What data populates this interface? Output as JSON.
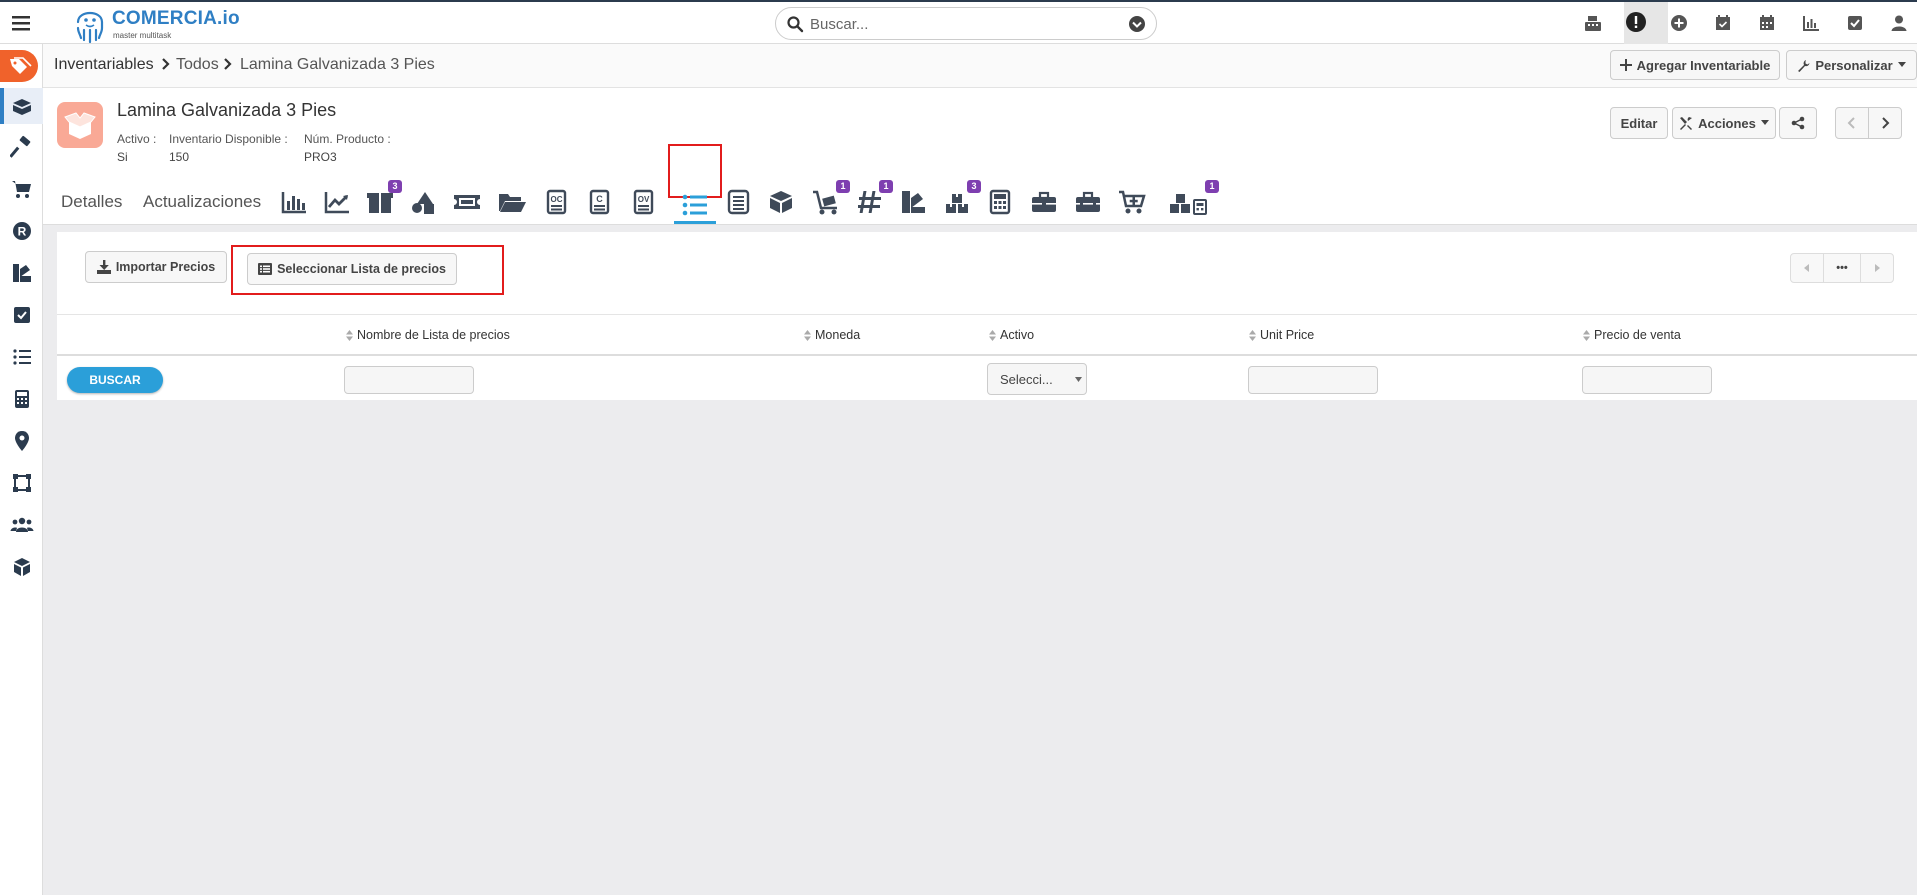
{
  "app": {
    "logo_text": "COMERCIA.io",
    "logo_subtitle": "master multitask"
  },
  "search": {
    "placeholder": "Buscar..."
  },
  "breadcrumb": [
    "Inventariables",
    "Todos",
    "Lamina Galvanizada 3 Pies"
  ],
  "header_buttons": {
    "add": "Agregar Inventariable",
    "customize": "Personalizar"
  },
  "record": {
    "title": "Lamina Galvanizada 3 Pies",
    "fields": [
      {
        "label": "Activo :",
        "value": "Si"
      },
      {
        "label": "Inventario Disponible :",
        "value": "150"
      },
      {
        "label": "Núm. Producto :",
        "value": "PRO3"
      }
    ],
    "edit_label": "Editar",
    "actions_label": "Acciones"
  },
  "tabs": {
    "text": [
      "Detalles",
      "Actualizaciones"
    ],
    "badges": {
      "boxes": "3",
      "cart": "1",
      "hash": "1",
      "warehouse": "3",
      "warehouse_calc": "1"
    }
  },
  "toolbar": {
    "import_label": "Importar Precios",
    "select_label": "Seleccionar Lista de precios",
    "more_label": "•••"
  },
  "table": {
    "columns": [
      "Nombre de Lista de precios",
      "Moneda",
      "Activo",
      "Unit Price",
      "Precio de venta"
    ],
    "search_button": "BUSCAR",
    "activo_select": "Selecci..."
  },
  "colors": {
    "brand": "#2f7fc4",
    "accent_orange": "#f0622b",
    "badge": "#7e3fb0",
    "search_button": "#2b9fd9",
    "highlight": "#e21c1c"
  }
}
